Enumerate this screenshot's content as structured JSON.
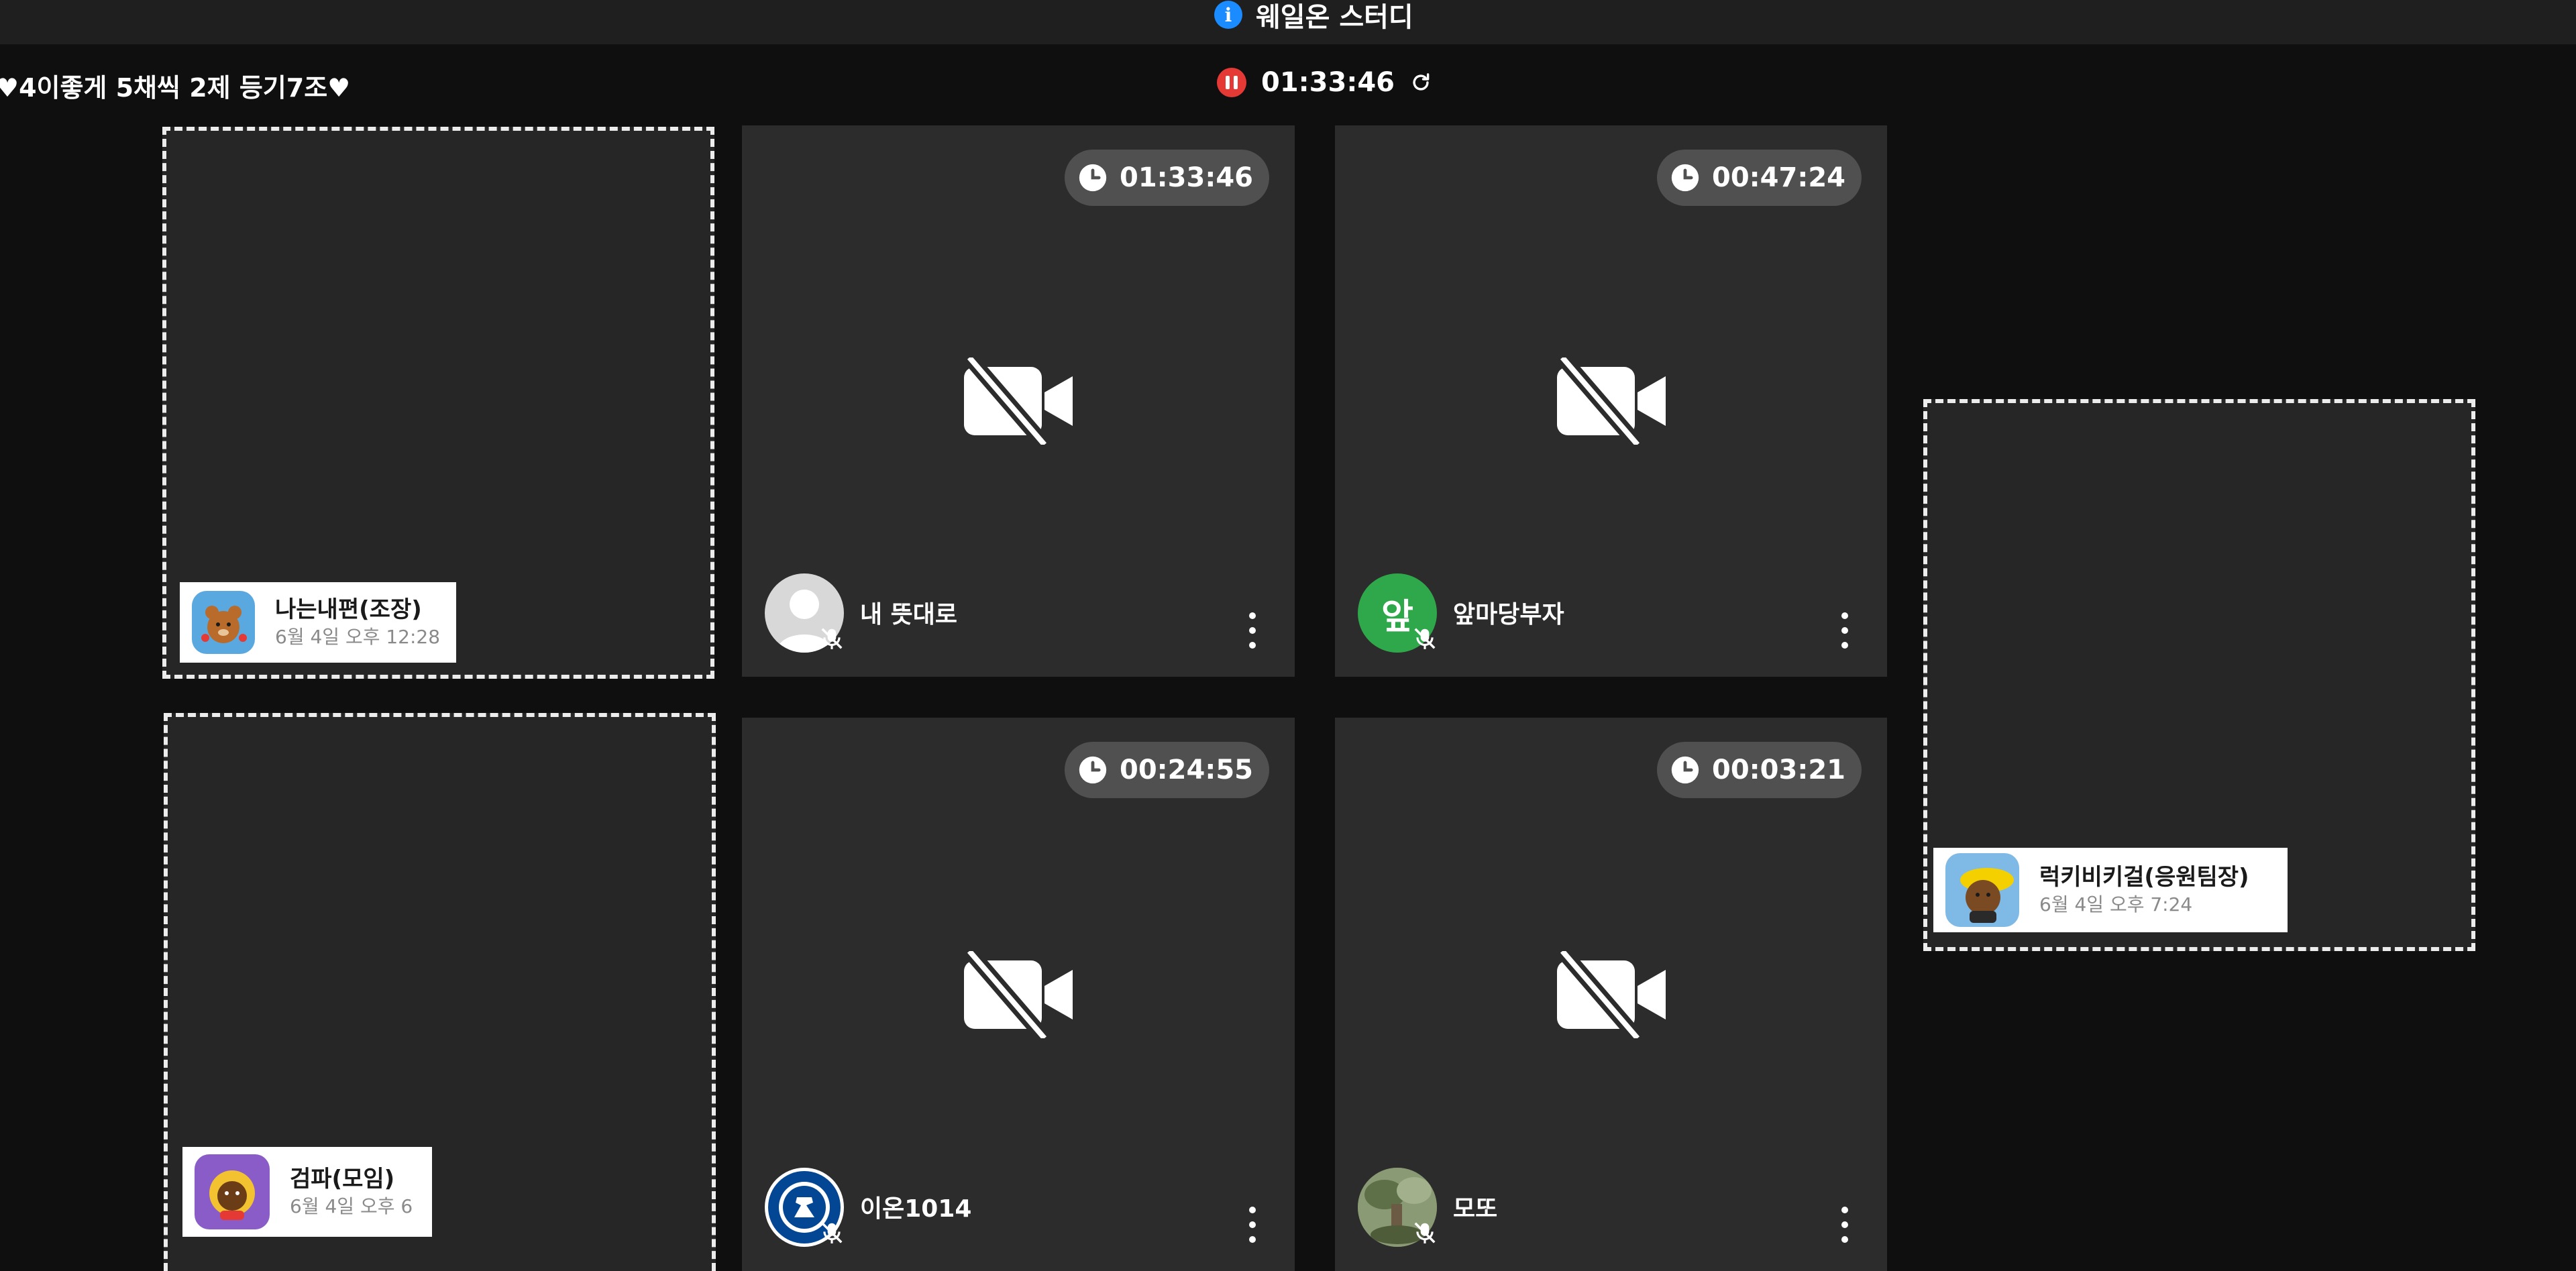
{
  "header": {
    "room_title": "웨일온 스터디",
    "info_icon": "info-icon",
    "info_glyph": "i",
    "accent_color": "#1a8cff"
  },
  "notice": "♥4이좋게 5채씩 2제 등기7조♥",
  "session": {
    "timer": "01:33:46",
    "status_icon": "pause-icon",
    "status_color": "#e53935",
    "refresh_icon": "refresh-icon"
  },
  "empty_tiles": [
    {
      "name": "나는내편(조장)",
      "date": "6월 4일 오후 12:28",
      "avatar_icon": "bear-avatar-icon"
    },
    {
      "name": "검파(모임)",
      "date": "6월 4일 오후 6",
      "avatar_icon": "character-avatar-icon"
    },
    {
      "name": "럭키비키걸(응원팀장)",
      "date": "6월 4일 오후 7:24",
      "avatar_icon": "character-avatar-icon"
    }
  ],
  "participants": [
    {
      "name": "내 뜻대로",
      "elapsed": "01:33:46",
      "avatar_icon": "default-user-avatar-icon",
      "camera": "off",
      "mic": "muted"
    },
    {
      "name": "앞마당부자",
      "elapsed": "00:47:24",
      "avatar_icon": "letter-avatar-icon",
      "avatar_letter": "앞",
      "avatar_color": "#2ea84a",
      "camera": "off",
      "mic": "muted"
    },
    {
      "name": "이온1014",
      "elapsed": "00:24:55",
      "avatar_icon": "chelsea-logo-avatar-icon",
      "camera": "off",
      "mic": "muted"
    },
    {
      "name": "모또",
      "elapsed": "00:03:21",
      "avatar_icon": "photo-avatar-icon",
      "camera": "off",
      "mic": "muted"
    }
  ]
}
